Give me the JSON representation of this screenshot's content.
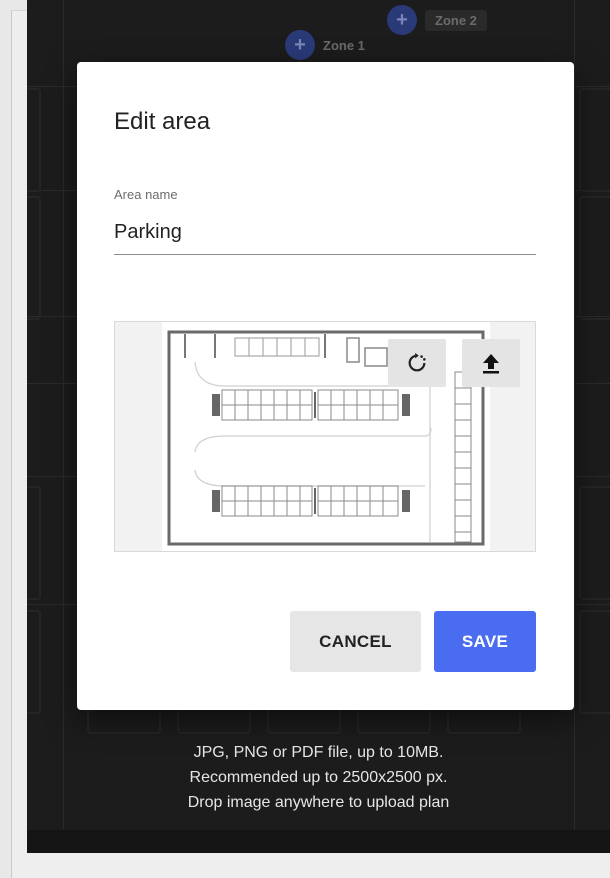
{
  "background": {
    "zones": [
      "Zone 1",
      "Zone 2"
    ],
    "help_lines": [
      "JPG, PNG or PDF file, up to 10MB.",
      "Recommended up to 2500x2500 px.",
      "Drop image anywhere to upload plan"
    ]
  },
  "dialog": {
    "title": "Edit area",
    "field_label": "Area name",
    "field_value": "Parking",
    "rotate_icon": "rotate-icon",
    "upload_icon": "upload-icon",
    "cancel_label": "CANCEL",
    "save_label": "SAVE"
  },
  "colors": {
    "primary": "#4a6cf0",
    "overlay": "#1c1c1c",
    "button_grey": "#e6e6e6"
  }
}
